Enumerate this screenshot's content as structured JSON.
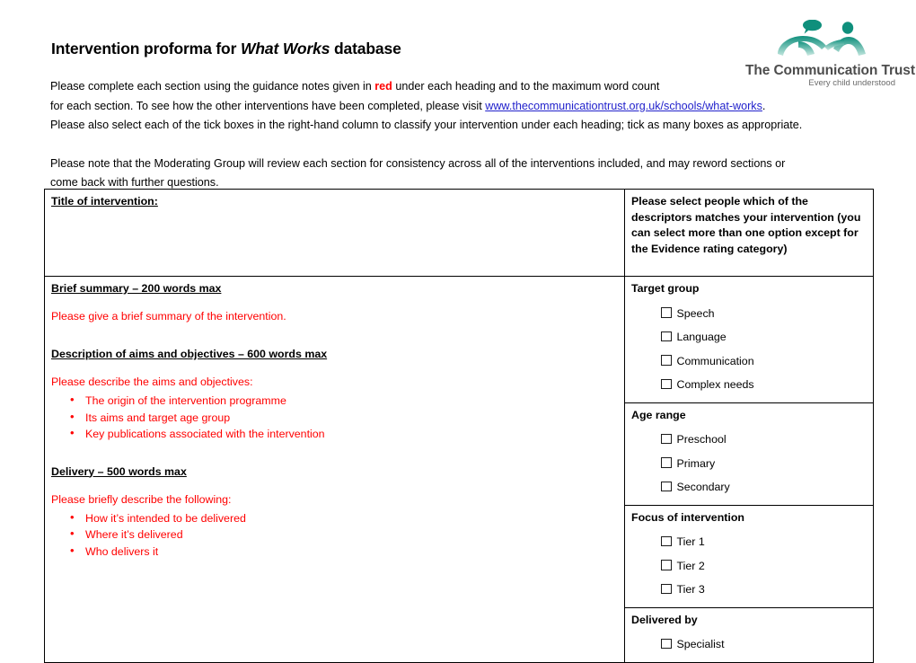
{
  "logo": {
    "name": "The Communication Trust",
    "tagline": "Every child understood",
    "mark": "two-figures-speech-bubble-logo",
    "color": "#1f9e8c"
  },
  "header": {
    "title_before": "Intervention proforma for ",
    "title_italic": "What Works",
    "title_after": " database",
    "intro_line1_a": "Please complete each section using the guidance notes given in ",
    "intro_red_word": "red",
    "intro_line1_b": " under each heading and to the maximum word count",
    "intro_line2_a": "for each section. To see how the other interventions have been completed, please visit ",
    "intro_link": "www.thecommunicationtrust.org.uk/schools/what-works",
    "intro_line2_b": ".",
    "intro_line3": "Please also select each of the tick boxes in the right-hand column to classify your intervention under each heading; tick as many boxes as appropriate.",
    "intro_note_line1": "Please note that the Moderating Group will review each section for consistency across all of the interventions included, and may reword sections or",
    "intro_note_line2": "come back with further questions."
  },
  "table": {
    "right_header": "Please select people which of the descriptors matches your intervention (you can select more than one option except for the Evidence rating category)",
    "sections": [
      {
        "heading": "Title of intervention: ",
        "guidance": "",
        "bullets": []
      },
      {
        "heading": "Brief summary – 200 words max",
        "guidance": "Please give a brief summary of the intervention.",
        "bullets": []
      },
      {
        "heading": "Description of aims and objectives – 600 words max ",
        "guidance": "Please describe the aims and objectives:",
        "bullets": [
          "The origin of the intervention programme",
          "Its aims and target age group",
          "Key publications associated with the intervention"
        ]
      },
      {
        "heading": "Delivery – 500 words max",
        "guidance": "Please briefly describe the following:",
        "bullets": [
          "How it’s intended to be delivered",
          "Where it’s delivered",
          "Who delivers it"
        ]
      }
    ],
    "categories": [
      {
        "title": "Target group",
        "options": [
          "Speech",
          "Language",
          "Communication",
          "Complex needs"
        ]
      },
      {
        "title": "Age range",
        "options": [
          "Preschool",
          "Primary",
          "Secondary"
        ]
      },
      {
        "title": "Focus of intervention",
        "options": [
          "Tier 1",
          "Tier 2",
          "Tier 3"
        ]
      },
      {
        "title": "Delivered by",
        "options": [
          "Specialist"
        ]
      }
    ],
    "checkbox_state": "unchecked",
    "guidance_color": "#ff0000",
    "link_color": "#2222cc"
  }
}
